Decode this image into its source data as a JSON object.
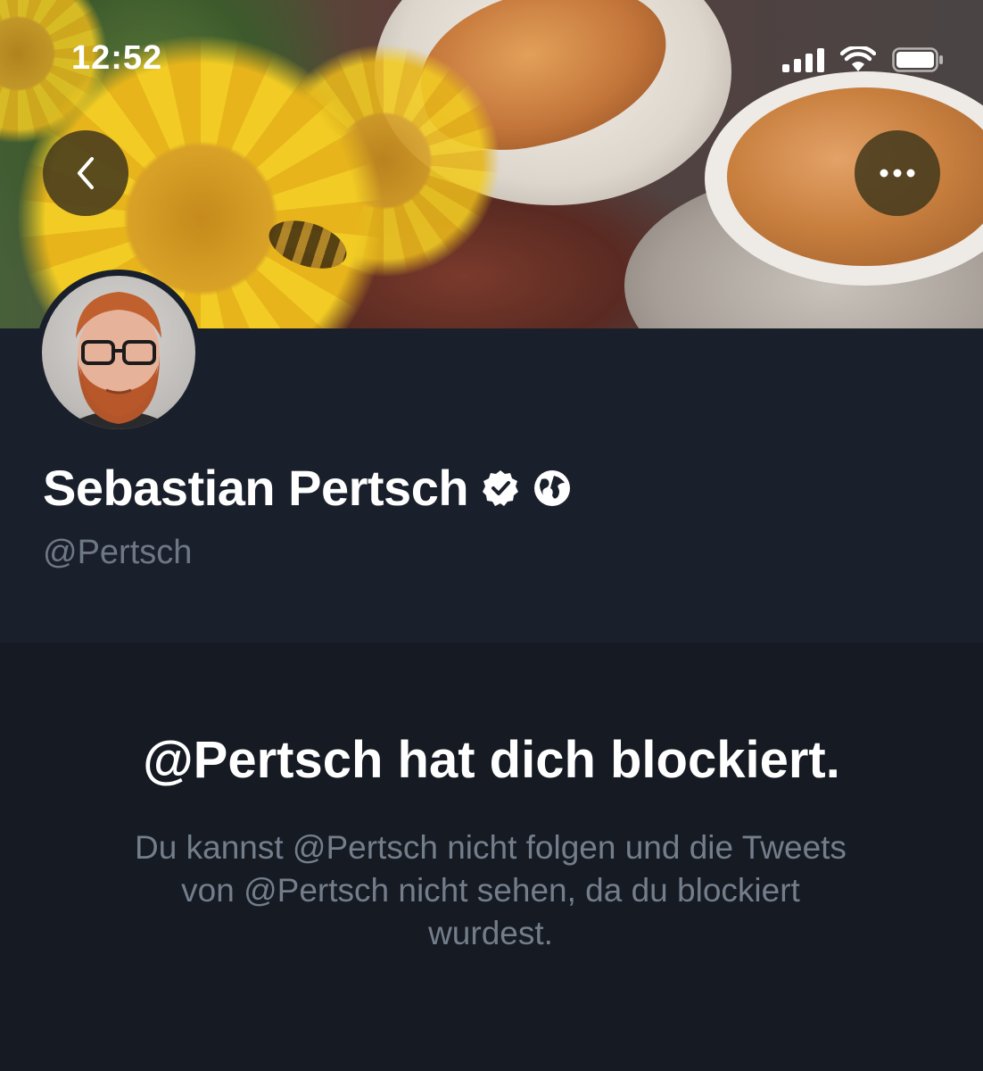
{
  "status_bar": {
    "time": "12:52",
    "signal_icon": "cellular-signal-icon",
    "wifi_icon": "wifi-icon",
    "battery_icon": "battery-icon"
  },
  "nav": {
    "back_icon": "chevron-left-icon",
    "more_icon": "more-horizontal-icon"
  },
  "profile": {
    "display_name": "Sebastian Pertsch",
    "handle": "@Pertsch",
    "verified_icon": "verified-badge-icon",
    "globe_icon": "globe-icon"
  },
  "blocked": {
    "title": "@Pertsch hat dich blockiert.",
    "message": "Du kannst @Pertsch nicht folgen und die Tweets von @Pertsch nicht sehen, da du blockiert wurdest."
  },
  "colors": {
    "page_background": "#151a23",
    "header_background": "#1a202b",
    "secondary_text": "#747e8b"
  }
}
